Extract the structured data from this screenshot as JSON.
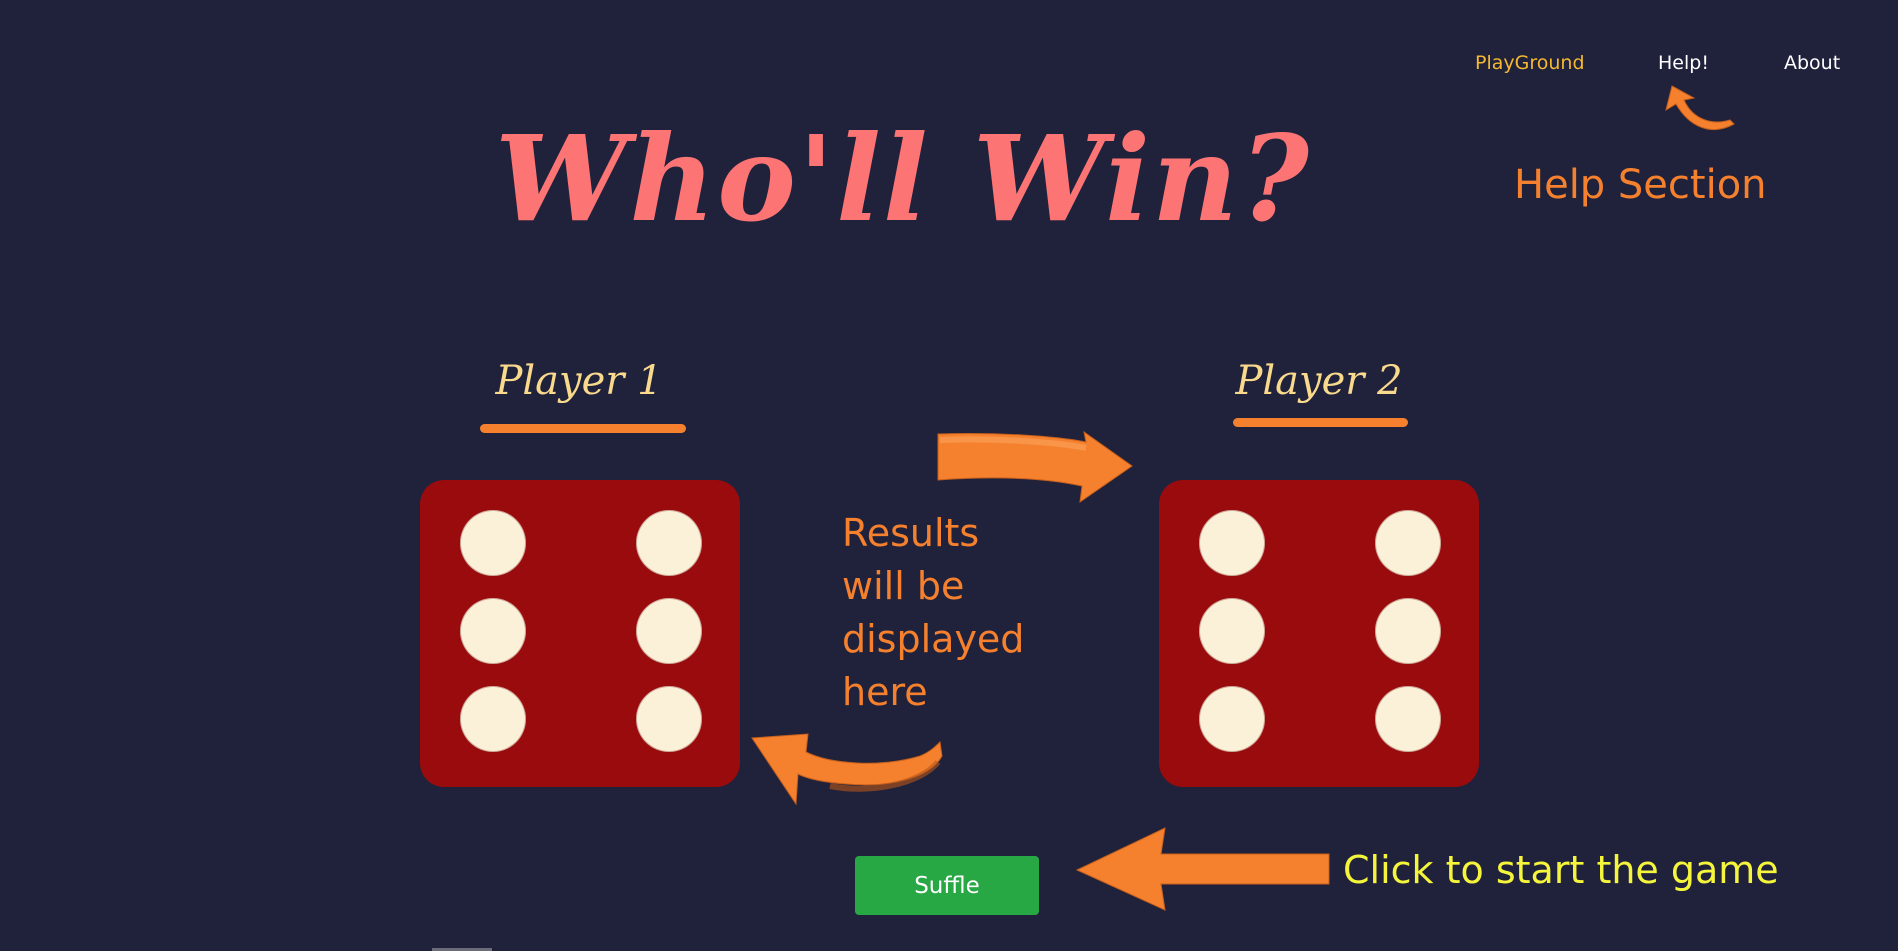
{
  "colors": {
    "background": "#20223b",
    "nav_active": "#f5b830",
    "nav_default": "#ffffff",
    "title": "#fd7475",
    "accent_orange": "#f5802e",
    "player_label": "#f9d98c",
    "die_face": "#9a0b0e",
    "pip": "#fbf1d9",
    "button_bg": "#28a745",
    "button_text": "#ffffff",
    "cta_text": "#f5f53c"
  },
  "nav": {
    "items": [
      {
        "label": "PlayGround",
        "active": true
      },
      {
        "label": "Help!",
        "active": false
      },
      {
        "label": "About",
        "active": false
      }
    ]
  },
  "title": "Who'll Win?",
  "help_note": "Help Section",
  "players": [
    {
      "label": "Player 1",
      "die_value": 6
    },
    {
      "label": "Player 2",
      "die_value": 6
    }
  ],
  "results_text": "Results will be displayed here",
  "shuffle_button": {
    "label": "Suffle"
  },
  "cta_text": "Click to start the game",
  "icons": {
    "help_arrow": "curved-arrow-icon",
    "results_top_arrow": "curved-right-arrow-icon",
    "results_bottom_arrow": "curved-left-arrow-icon",
    "button_arrow": "left-arrow-icon"
  }
}
